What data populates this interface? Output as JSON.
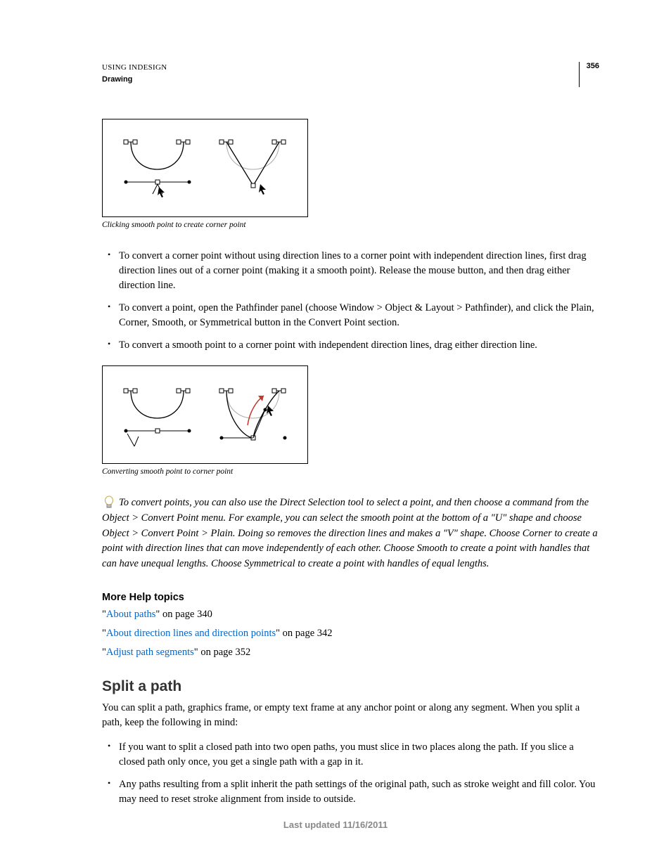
{
  "header": {
    "title": "USING INDESIGN",
    "section": "Drawing",
    "page_number": "356"
  },
  "figure1_caption": "Clicking smooth point to create corner point",
  "bullets1": {
    "b1": "To convert a corner point without using direction lines to a corner point with independent direction lines, first drag direction lines out of a corner point (making it a smooth point). Release the mouse button, and then drag either direction line.",
    "b2": "To convert a point, open the Pathfinder panel (choose Window > Object & Layout > Pathfinder), and click the Plain, Corner, Smooth, or Symmetrical button in the Convert Point section.",
    "b3": "To convert a smooth point to a corner point with independent direction lines, drag either direction line."
  },
  "figure2_caption": "Converting smooth point to corner point",
  "tip_text": "To convert points, you can also use the Direct Selection tool to select a point, and then choose a command from the Object > Convert Point menu. For example, you can select the smooth point at the bottom of a \"U\" shape and choose Object > Convert Point > Plain. Doing so removes the direction lines and makes a \"V\" shape. Choose Corner to create a point with direction lines that can move independently of each other. Choose Smooth to create a point with handles that can have unequal lengths. Choose Symmetrical to create a point with handles of equal lengths.",
  "help": {
    "heading": "More Help topics",
    "items": [
      {
        "prefix": "\"",
        "link": "About paths",
        "suffix": "\" on page 340"
      },
      {
        "prefix": "\"",
        "link": "About direction lines and direction points",
        "suffix": "\" on page 342"
      },
      {
        "prefix": "\"",
        "link": "Adjust path segments",
        "suffix": "\" on page 352"
      }
    ]
  },
  "section2": {
    "heading": "Split a path",
    "body": "You can split a path, graphics frame, or empty text frame at any anchor point or along any segment. When you split a path, keep the following in mind:",
    "bullets": {
      "b1": "If you want to split a closed path into two open paths, you must slice in two places along the path. If you slice a closed path only once, you get a single path with a gap in it.",
      "b2": "Any paths resulting from a split inherit the path settings of the original path, such as stroke weight and fill color. You may need to reset stroke alignment from inside to outside."
    }
  },
  "footer_text": "Last updated 11/16/2011"
}
